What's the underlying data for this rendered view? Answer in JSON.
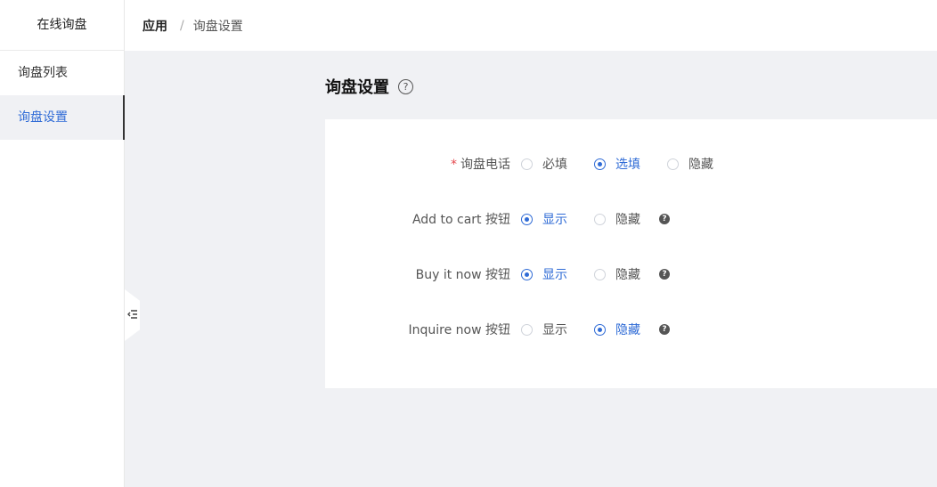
{
  "sidebar": {
    "title": "在线询盘",
    "items": [
      {
        "label": "询盘列表"
      },
      {
        "label": "询盘设置"
      }
    ]
  },
  "breadcrumb": {
    "root": "应用",
    "separator": "/",
    "current": "询盘设置"
  },
  "page": {
    "title": "询盘设置",
    "help_glyph": "?"
  },
  "form": {
    "rows": [
      {
        "required_mark": "*",
        "label": "询盘电话",
        "options": [
          "必填",
          "选填",
          "隐藏"
        ],
        "selected": "选填"
      },
      {
        "label": "Add to cart 按钮",
        "options": [
          "显示",
          "隐藏"
        ],
        "selected": "显示",
        "help": "?"
      },
      {
        "label": "Buy it now 按钮",
        "options": [
          "显示",
          "隐藏"
        ],
        "selected": "显示",
        "help": "?"
      },
      {
        "label": "Inquire now 按钮",
        "options": [
          "显示",
          "隐藏"
        ],
        "selected": "隐藏",
        "help": "?"
      }
    ]
  },
  "colors": {
    "accent": "#2f6bd6",
    "background": "#f0f1f4",
    "required": "#e5484d"
  },
  "icons": {
    "collapse": "collapse-sidebar-icon",
    "help": "help-circle-icon"
  }
}
